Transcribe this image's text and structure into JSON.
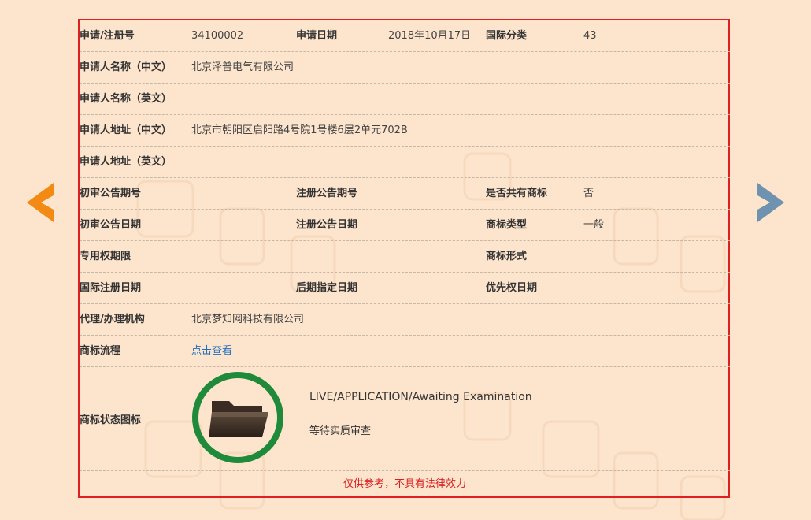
{
  "nav": {
    "prev_label": "",
    "next_label": ""
  },
  "rows": {
    "reg_no_label": "申请/注册号",
    "reg_no": "34100002",
    "apply_date_label": "申请日期",
    "apply_date": "2018年10月17日",
    "intl_class_label": "国际分类",
    "intl_class": "43",
    "applicant_cn_label": "申请人名称（中文）",
    "applicant_cn": "北京泽普电气有限公司",
    "applicant_en_label": "申请人名称（英文）",
    "applicant_en": "",
    "address_cn_label": "申请人地址（中文）",
    "address_cn": "北京市朝阳区启阳路4号院1号楼6层2单元702B",
    "address_en_label": "申请人地址（英文）",
    "address_en": "",
    "prelim_no_label": "初审公告期号",
    "prelim_no": "",
    "reg_pub_no_label": "注册公告期号",
    "reg_pub_no": "",
    "shared_label": "是否共有商标",
    "shared": "否",
    "prelim_date_label": "初审公告日期",
    "prelim_date": "",
    "reg_pub_date_label": "注册公告日期",
    "reg_pub_date": "",
    "tm_type_label": "商标类型",
    "tm_type": "一般",
    "exclusive_label": "专用权期限",
    "exclusive": "",
    "tm_form_label": "商标形式",
    "tm_form": "",
    "intl_reg_date_label": "国际注册日期",
    "intl_reg_date": "",
    "later_date_label": "后期指定日期",
    "later_date": "",
    "priority_date_label": "优先权日期",
    "priority_date": "",
    "agency_label": "代理/办理机构",
    "agency": "北京梦知网科技有限公司",
    "process_label": "商标流程",
    "process_link": "点击查看"
  },
  "status": {
    "label": "商标状态图标",
    "icon": "folder-icon",
    "en": "LIVE/APPLICATION/Awaiting Examination",
    "cn": "等待实质审查",
    "ring_color": "#1f8a3a"
  },
  "footer": {
    "disclaimer": "仅供参考，不具有法律效力"
  },
  "colors": {
    "background": "#fde5cd",
    "border": "#e02020",
    "prev_arrow": "#f28a14",
    "next_arrow": "#6f92b0",
    "link": "#1f6fbf"
  }
}
